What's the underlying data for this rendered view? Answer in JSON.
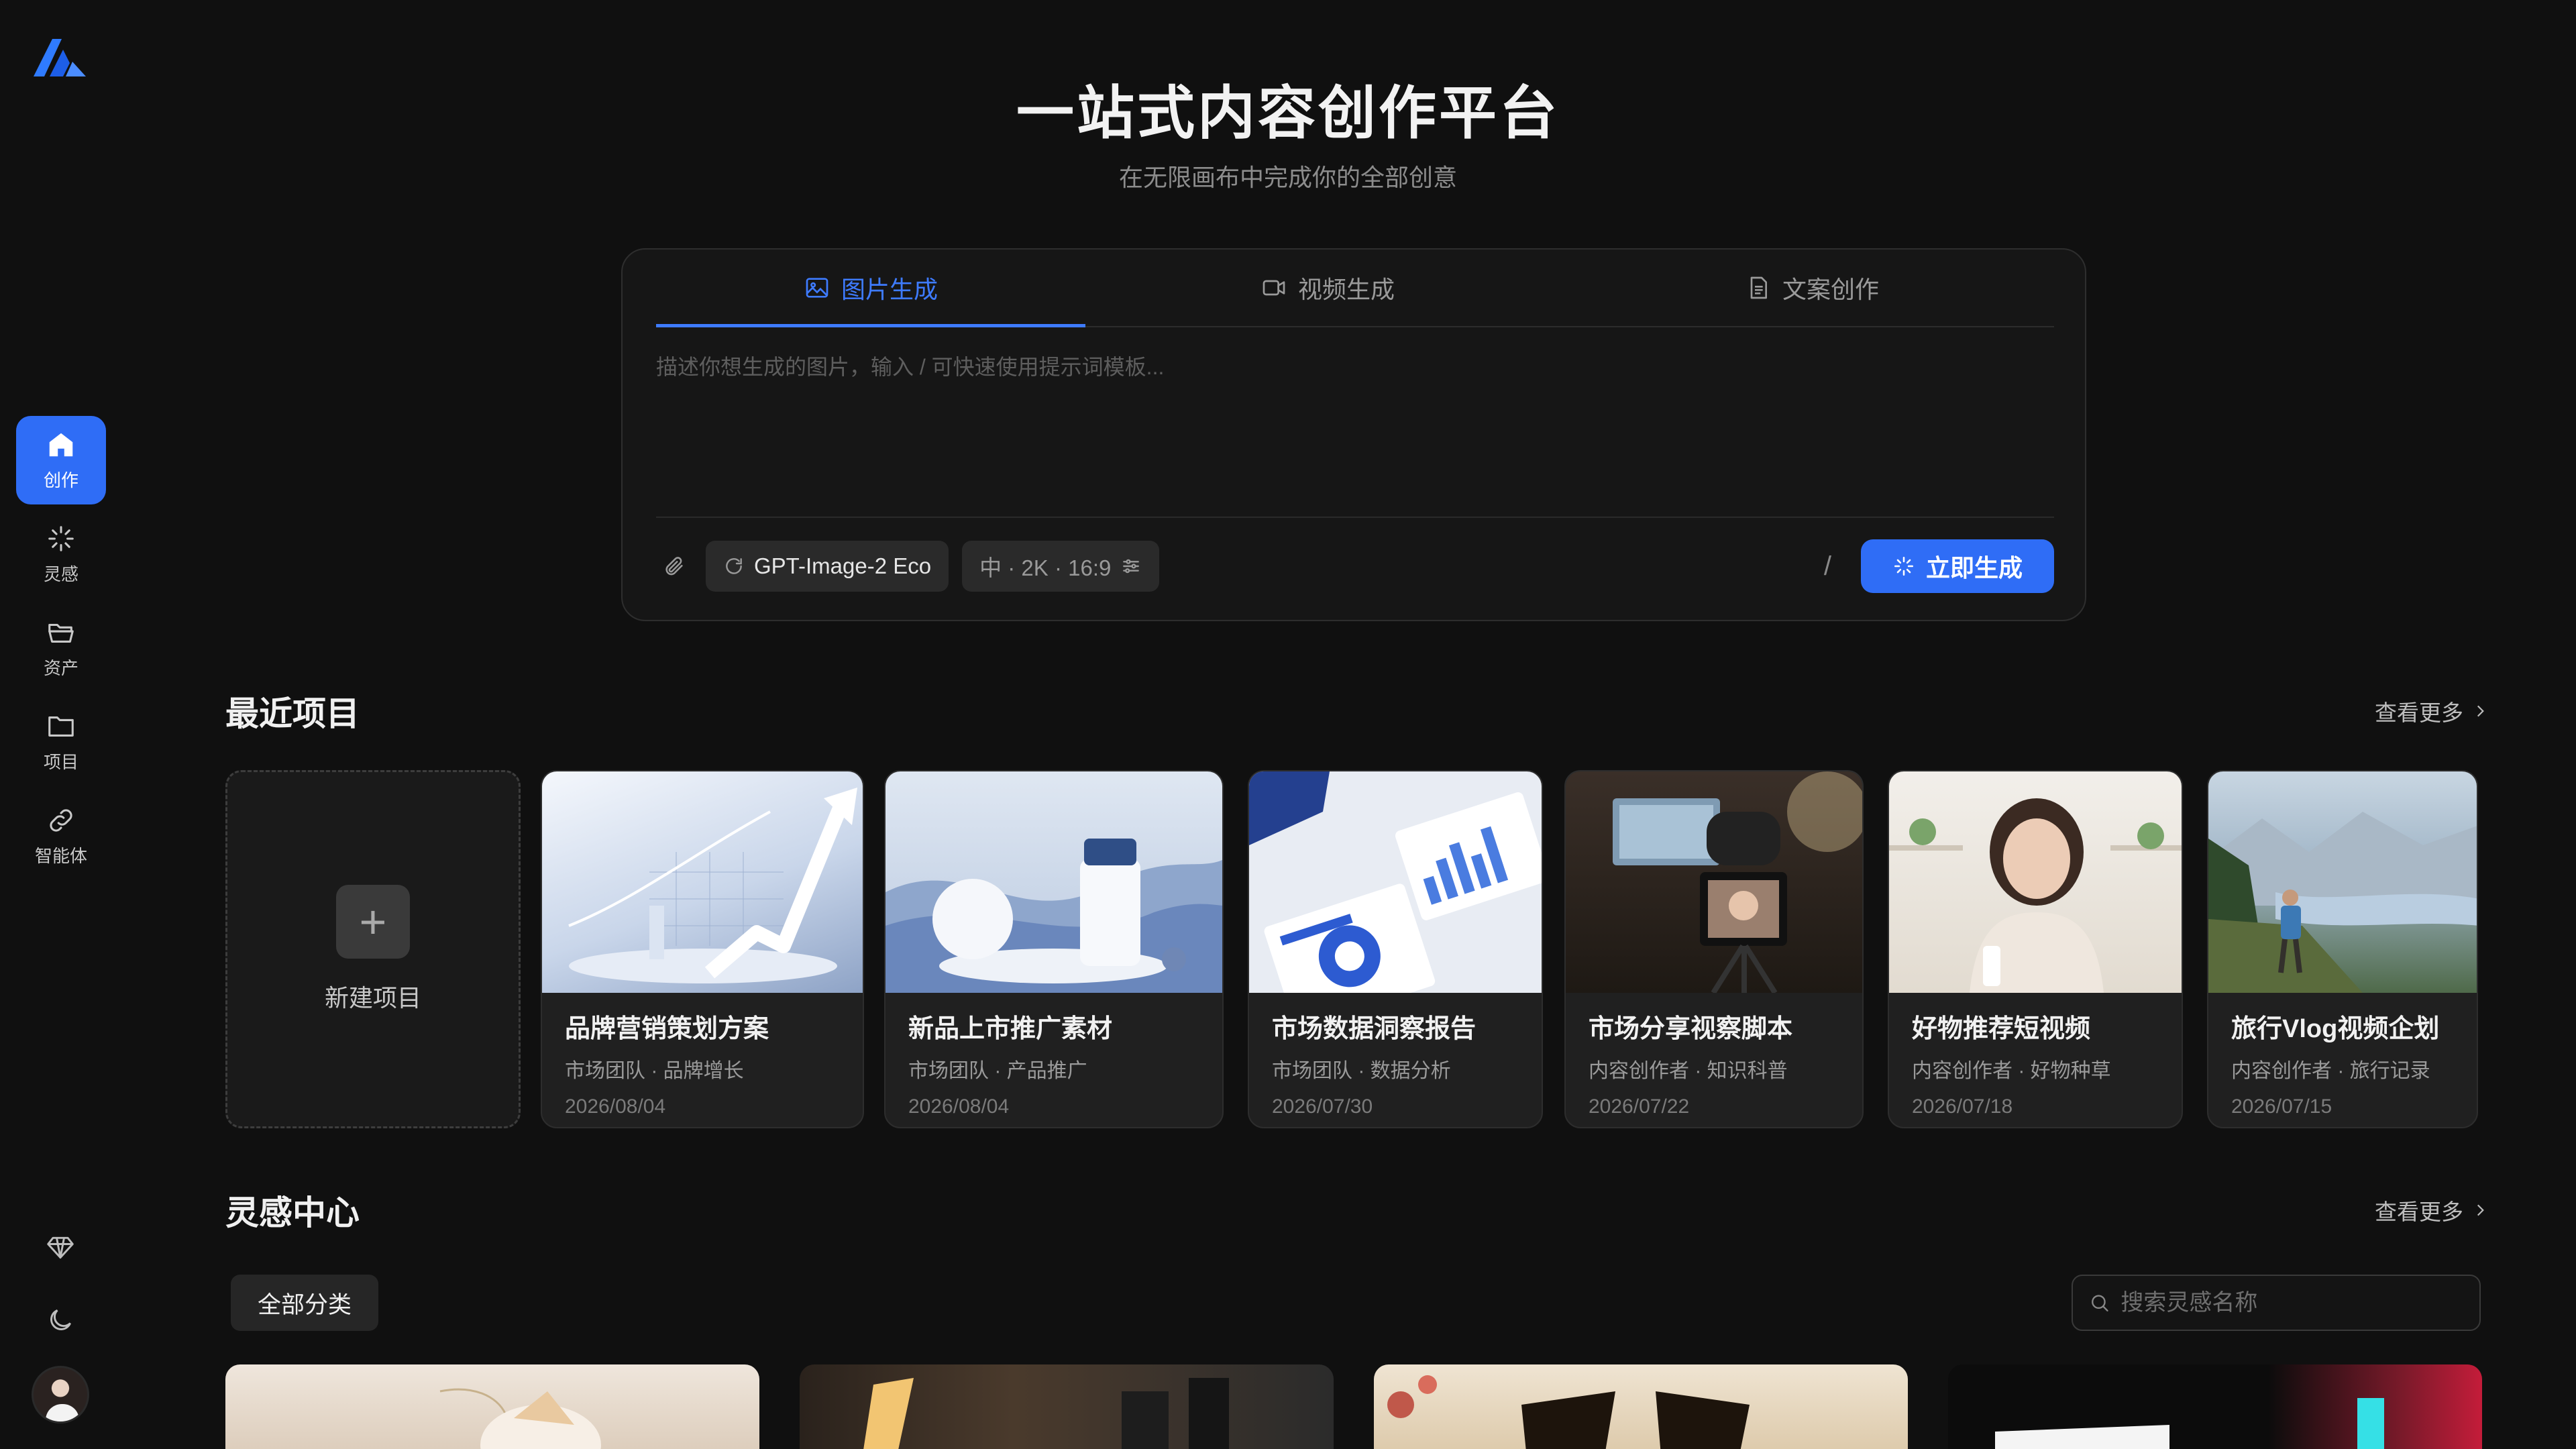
{
  "sidebar": {
    "items": [
      {
        "label": "创作",
        "icon": "home-icon"
      },
      {
        "label": "灵感",
        "icon": "sparkle-icon"
      },
      {
        "label": "资产",
        "icon": "folder-open-icon"
      },
      {
        "label": "项目",
        "icon": "folder-icon"
      },
      {
        "label": "智能体",
        "icon": "link-icon"
      }
    ],
    "bottom": [
      "diamond-icon",
      "moon-icon",
      "avatar"
    ]
  },
  "hero": {
    "title": "一站式内容创作平台",
    "subtitle": "在无限画布中完成你的全部创意"
  },
  "composer": {
    "tabs": [
      {
        "label": "图片生成",
        "icon": "image-icon",
        "active": true
      },
      {
        "label": "视频生成",
        "icon": "video-icon",
        "active": false
      },
      {
        "label": "文案创作",
        "icon": "document-icon",
        "active": false
      }
    ],
    "placeholder": "描述你想生成的图片，输入 / 可快速使用提示词模板...",
    "model": "GPT-Image-2 Eco",
    "settings": "中 · 2K · 16:9",
    "slash_hint": "/",
    "generate_label": "立即生成"
  },
  "recent": {
    "title": "最近项目",
    "see_more": "查看更多",
    "new_label": "新建项目",
    "projects": [
      {
        "title": "品牌营销策划方案",
        "meta": "市场团队 · 品牌增长",
        "date": "2026/08/04"
      },
      {
        "title": "新品上市推广素材",
        "meta": "市场团队 · 产品推广",
        "date": "2026/08/04"
      },
      {
        "title": "市场数据洞察报告",
        "meta": "市场团队 · 数据分析",
        "date": "2026/07/30"
      },
      {
        "title": "市场分享视察脚本",
        "meta": "内容创作者 · 知识科普",
        "date": "2026/07/22"
      },
      {
        "title": "好物推荐短视频",
        "meta": "内容创作者 · 好物种草",
        "date": "2026/07/18"
      },
      {
        "title": "旅行Vlog视频企划",
        "meta": "内容创作者 · 旅行记录",
        "date": "2026/07/15"
      }
    ]
  },
  "inspiration": {
    "title": "灵感中心",
    "see_more": "查看更多",
    "filter": "全部分类",
    "search_placeholder": "搜索灵感名称"
  },
  "colors": {
    "background": "#101010",
    "accent": "#2f6df6",
    "card": "#202020"
  }
}
